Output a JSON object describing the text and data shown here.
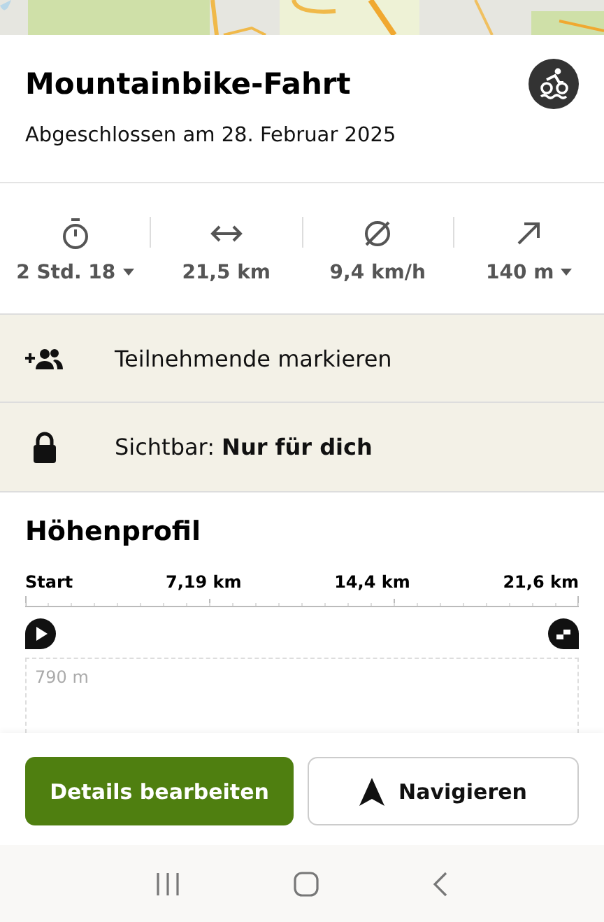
{
  "activity": {
    "title": "Mountainbike-Fahrt",
    "subtitle": "Abgeschlossen am 28. Februar 2025"
  },
  "stats": [
    {
      "kind": "duration",
      "value": "2 Std. 18",
      "dropdown": true
    },
    {
      "kind": "distance",
      "value": "21,5 km",
      "dropdown": false
    },
    {
      "kind": "speed",
      "value": "9,4 km/h",
      "dropdown": false
    },
    {
      "kind": "elevation",
      "value": "140 m",
      "dropdown": true
    }
  ],
  "rows": [
    {
      "kind": "tag",
      "text": "Teilnehmende markieren"
    },
    {
      "kind": "visibility",
      "text": "Sichtbar: **Nur für dich**"
    }
  ],
  "profile": {
    "title": "Höhenprofil",
    "axis_labels": [
      "Start",
      "7,19 km",
      "14,4 km",
      "21,6 km"
    ],
    "elevation_label": "790 m"
  },
  "buttons": [
    {
      "kind": "primary",
      "label": "Details bearbeiten"
    },
    {
      "kind": "navigate",
      "label": "Navigieren"
    }
  ]
}
